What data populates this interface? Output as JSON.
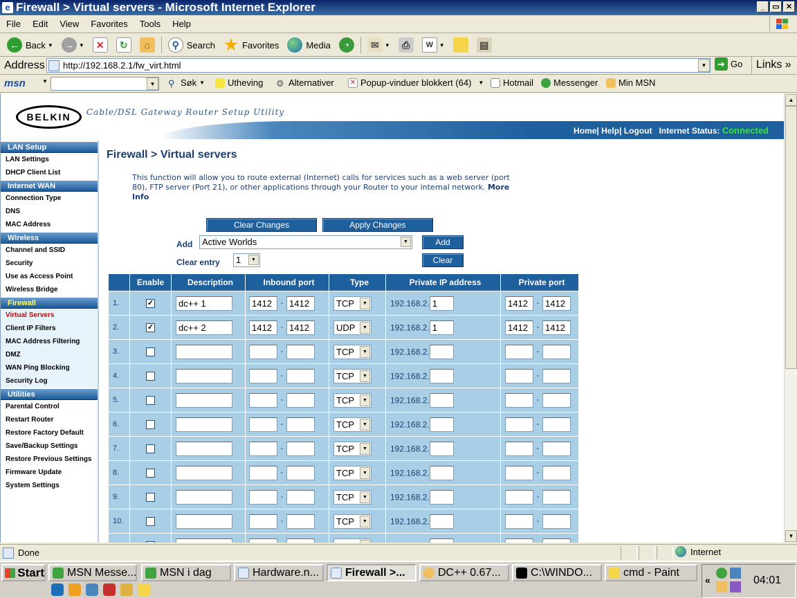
{
  "window": {
    "title": "Firewall > Virtual servers - Microsoft Internet Explorer",
    "min": "_",
    "max": "▭",
    "close": "✕"
  },
  "menu": [
    "File",
    "Edit",
    "View",
    "Favorites",
    "Tools",
    "Help"
  ],
  "toolbar": {
    "back": "Back",
    "search": "Search",
    "favorites": "Favorites",
    "media": "Media"
  },
  "address": {
    "label": "Address",
    "url": "http://192.168.2.1/fw_virt.html",
    "go": "Go",
    "links": "Links"
  },
  "msnbar": {
    "logo": "msn",
    "search_label": "Søk",
    "highlight": "Utheving",
    "options": "Alternativer",
    "popup": "Popup-vinduer blokkert (64)",
    "hotmail": "Hotmail",
    "messenger": "Messenger",
    "my_msn": "Min MSN"
  },
  "router": {
    "logo": "BELKIN",
    "subtitle": "Cable/DSL Gateway Router Setup Utility",
    "header_links": {
      "home": "Home",
      "help": "Help",
      "logout": "Logout",
      "status_label": "Internet Status:",
      "status_value": "Connected"
    },
    "sidebar": [
      {
        "heading": "LAN Setup",
        "items": [
          "LAN Settings",
          "DHCP Client List"
        ]
      },
      {
        "heading": "Internet WAN",
        "items": [
          "Connection Type",
          "DNS",
          "MAC Address"
        ]
      },
      {
        "heading": "Wireless",
        "items": [
          "Channel and SSID",
          "Security",
          "Use as Access Point",
          "Wireless Bridge"
        ]
      },
      {
        "heading": "Firewall",
        "items": [
          "Virtual Servers",
          "Client IP Filters",
          "MAC Address Filtering",
          "DMZ",
          "WAN Ping Blocking",
          "Security Log"
        ]
      },
      {
        "heading": "Utilities",
        "items": [
          "Parental Control",
          "Restart Router",
          "Restore Factory Default",
          "Save/Backup Settings",
          "Restore Previous Settings",
          "Firmware Update",
          "System Settings"
        ]
      }
    ],
    "page_title": "Firewall > Virtual servers",
    "intro_text": "This function will allow you to route external (Internet) calls for services such as a web server (port 80), FTP server (Port 21), or other applications through your Router to your internal network.",
    "more_info": "More Info",
    "buttons": {
      "clear_changes": "Clear Changes",
      "apply_changes": "Apply Changes",
      "add": "Add",
      "clear": "Clear"
    },
    "add_label": "Add",
    "add_selected": "Active Worlds",
    "clear_entry_label": "Clear entry",
    "clear_entry_value": "1",
    "table": {
      "headers": [
        "",
        "Enable",
        "Description",
        "Inbound port",
        "Type",
        "Private IP address",
        "Private port"
      ],
      "ip_prefix": "192.168.2.",
      "rows": [
        {
          "num": "1.",
          "enabled": true,
          "desc": "dc++ 1",
          "in_from": "1412",
          "in_to": "1412",
          "type": "TCP",
          "ip": "1",
          "priv_from": "1412",
          "priv_to": "1412"
        },
        {
          "num": "2.",
          "enabled": true,
          "desc": "dc++ 2",
          "in_from": "1412",
          "in_to": "1412",
          "type": "UDP",
          "ip": "1",
          "priv_from": "1412",
          "priv_to": "1412"
        },
        {
          "num": "3.",
          "enabled": false,
          "desc": "",
          "in_from": "",
          "in_to": "",
          "type": "TCP",
          "ip": "",
          "priv_from": "",
          "priv_to": ""
        },
        {
          "num": "4.",
          "enabled": false,
          "desc": "",
          "in_from": "",
          "in_to": "",
          "type": "TCP",
          "ip": "",
          "priv_from": "",
          "priv_to": ""
        },
        {
          "num": "5.",
          "enabled": false,
          "desc": "",
          "in_from": "",
          "in_to": "",
          "type": "TCP",
          "ip": "",
          "priv_from": "",
          "priv_to": ""
        },
        {
          "num": "6.",
          "enabled": false,
          "desc": "",
          "in_from": "",
          "in_to": "",
          "type": "TCP",
          "ip": "",
          "priv_from": "",
          "priv_to": ""
        },
        {
          "num": "7.",
          "enabled": false,
          "desc": "",
          "in_from": "",
          "in_to": "",
          "type": "TCP",
          "ip": "",
          "priv_from": "",
          "priv_to": ""
        },
        {
          "num": "8.",
          "enabled": false,
          "desc": "",
          "in_from": "",
          "in_to": "",
          "type": "TCP",
          "ip": "",
          "priv_from": "",
          "priv_to": ""
        },
        {
          "num": "9.",
          "enabled": false,
          "desc": "",
          "in_from": "",
          "in_to": "",
          "type": "TCP",
          "ip": "",
          "priv_from": "",
          "priv_to": ""
        },
        {
          "num": "10.",
          "enabled": false,
          "desc": "",
          "in_from": "",
          "in_to": "",
          "type": "TCP",
          "ip": "",
          "priv_from": "",
          "priv_to": ""
        },
        {
          "num": "",
          "enabled": false,
          "desc": "",
          "in_from": "",
          "in_to": "",
          "type": "TCP",
          "ip": "",
          "priv_from": "",
          "priv_to": ""
        }
      ]
    }
  },
  "statusbar": {
    "text": "Done",
    "zone": "Internet"
  },
  "taskbar": {
    "start": "Start",
    "tasks": [
      "MSN Messe...",
      "MSN i dag",
      "Hardware.n...",
      "Firewall >...",
      "DC++ 0.67...",
      "C:\\WINDO...",
      "cmd - Paint"
    ],
    "active_task": 3,
    "clock": "04:01",
    "tray_expand": "«"
  },
  "colors": {
    "accent": "#1e5f9e",
    "table_row": "#a9cfe6",
    "connected": "#39e639"
  }
}
